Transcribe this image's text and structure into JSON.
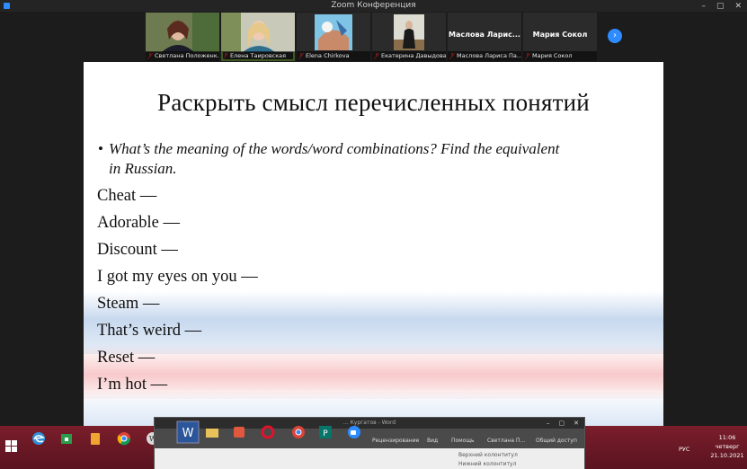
{
  "window": {
    "title": "Zoom Конференция"
  },
  "participants": [
    {
      "name": "Светлана Положенк...",
      "type": "video",
      "active": false
    },
    {
      "name": "Елена Таировская",
      "type": "video",
      "active": true
    },
    {
      "name": "Elena Chirkova",
      "type": "video",
      "active": false
    },
    {
      "name": "Екатерина Давыдова",
      "type": "video",
      "active": false
    },
    {
      "name": "Маслова Лариса Па...",
      "display_name": "Маслова Ларис...",
      "type": "name",
      "active": false
    },
    {
      "name": "Мария Сокол",
      "display_name": "Мария Сокол",
      "type": "name",
      "active": false
    }
  ],
  "slide": {
    "title": "Раскрыть смысл перечисленных понятий",
    "bullet_line1": "What’s the meaning of the words/word combinations? Find the equivalent",
    "bullet_line2": "in Russian.",
    "items": [
      "Cheat —",
      "Adorable —",
      "Discount —",
      "I got my eyes on you —",
      "Steam —",
      "That’s weird —",
      "Reset —",
      "I’m hot —"
    ]
  },
  "word_window": {
    "title": "... Кургатов - Word",
    "tabs": [
      "Рецензирование",
      "Вид",
      "Помощь",
      "Светлана П...",
      "Общий доступ"
    ],
    "ribbon_items": [
      "Верхний колонтитул",
      "Нижний колонтитул"
    ]
  },
  "tray": {
    "language": "РУС",
    "time": "11:06",
    "day": "четверг",
    "date": "21.10.2021"
  },
  "colors": {
    "accent": "#2d8cff",
    "active_speaker": "#8bc34a",
    "taskbar": "#6b1826"
  }
}
